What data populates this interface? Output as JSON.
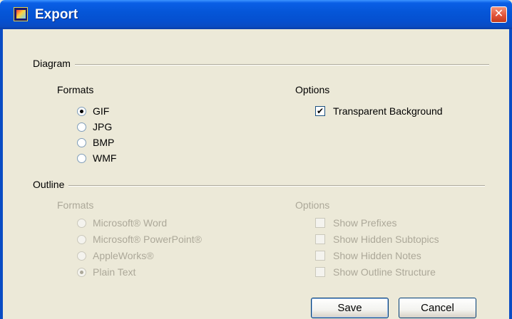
{
  "window": {
    "title": "Export",
    "close_symbol": "✕"
  },
  "diagram": {
    "group_label": "Diagram",
    "formats_label": "Formats",
    "options_label": "Options",
    "formats": [
      {
        "label": "GIF",
        "checked": true
      },
      {
        "label": "JPG",
        "checked": false
      },
      {
        "label": "BMP",
        "checked": false
      },
      {
        "label": "WMF",
        "checked": false
      }
    ],
    "options": [
      {
        "label": "Transparent Background",
        "checked": true,
        "mark": "✔"
      }
    ]
  },
  "outline": {
    "group_label": "Outline",
    "formats_label": "Formats",
    "options_label": "Options",
    "formats": [
      {
        "label": "Microsoft® Word",
        "checked": false
      },
      {
        "label": "Microsoft® PowerPoint®",
        "checked": false
      },
      {
        "label": "AppleWorks®",
        "checked": false
      },
      {
        "label": "Plain Text",
        "checked": true
      }
    ],
    "options": [
      {
        "label": "Show Prefixes",
        "checked": false
      },
      {
        "label": "Show Hidden Subtopics",
        "checked": false
      },
      {
        "label": "Show Hidden Notes",
        "checked": false
      },
      {
        "label": "Show Outline Structure",
        "checked": false
      }
    ],
    "enabled": false
  },
  "buttons": {
    "save": "Save",
    "cancel": "Cancel"
  }
}
